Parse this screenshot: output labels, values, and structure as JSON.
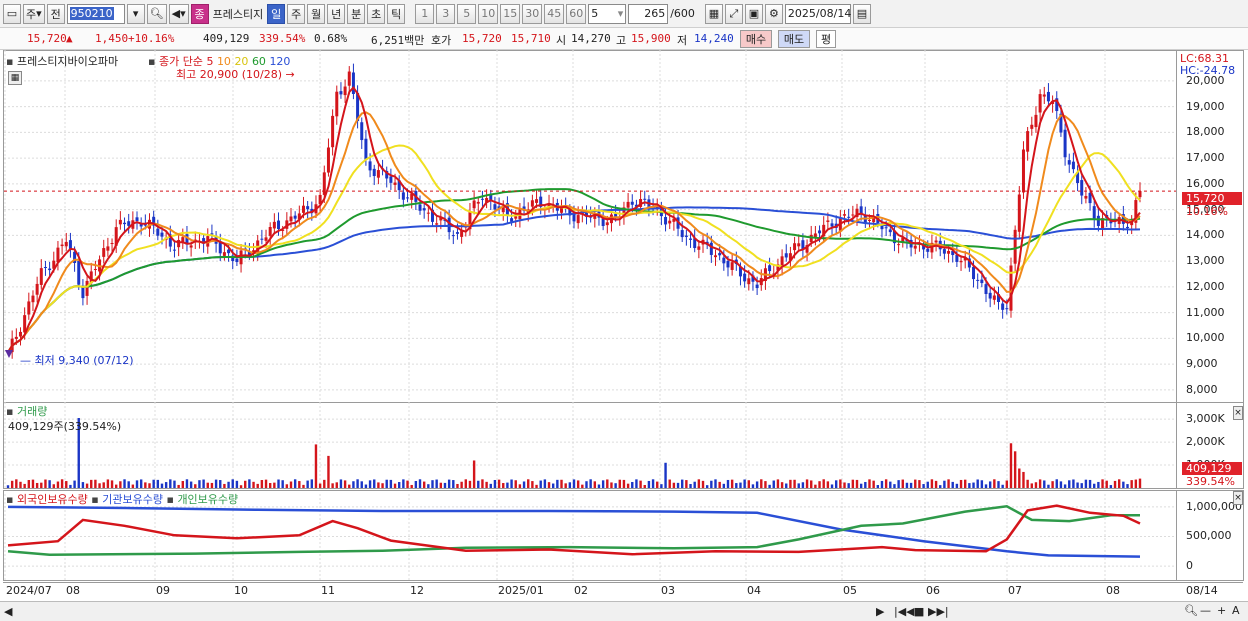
{
  "toolbar": {
    "market": "주",
    "code_prefix": "전",
    "code": "950210",
    "stock_badge": "종",
    "stock_name": "프레스티지",
    "periods": [
      "일",
      "주",
      "월",
      "년",
      "분",
      "초",
      "틱"
    ],
    "minutes": [
      "1",
      "3",
      "5",
      "10",
      "15",
      "30",
      "45",
      "60"
    ],
    "interval": "5",
    "count": "265",
    "count_max": "/600",
    "date": "2025/08/14"
  },
  "quote": {
    "price": "15,720",
    "change": "1,450",
    "change_pct": "+10.16%",
    "volume": "409,129",
    "volume_ratio": "339.54%",
    "turnover": "0.68%",
    "amount": "6,251백만",
    "hoga_label": "호가",
    "ask": "15,720",
    "bid": "15,710",
    "open_label": "시",
    "open": "14,270",
    "high_label": "고",
    "high": "15,900",
    "low_label": "저",
    "low": "14,240",
    "buy_label": "매수",
    "sell_label": "매도",
    "avg_label": "평"
  },
  "price_panel": {
    "name": "프레스티지바이오파마",
    "ma_label": "종가 단순",
    "ma_periods": [
      "5",
      "10",
      "20",
      "60",
      "120"
    ],
    "max_label": "최고 20,900 (10/28)",
    "min_label": "최저 9,340 (07/12)",
    "lc": "LC:68.31",
    "hc": "HC:-24.78",
    "current_price": "15,720",
    "current_pct": "10.16%",
    "yaxis": [
      "20,000",
      "19,000",
      "18,000",
      "17,000",
      "16,000",
      "15,000",
      "14,000",
      "13,000",
      "12,000",
      "11,000",
      "10,000",
      "9,000",
      "8,000"
    ]
  },
  "volume_panel": {
    "title": "거래량",
    "value": "409,129주(339.54%)",
    "yaxis": [
      "3,000K",
      "2,000K",
      "1,000K"
    ],
    "current": "409,129",
    "current_pct": "339.54%"
  },
  "holding_panel": {
    "foreign": "외국인보유수량",
    "institution": "기관보유수량",
    "individual": "개인보유수량",
    "yaxis": [
      "1,000,000",
      "500,000",
      "0"
    ]
  },
  "xaxis": [
    "2024/07",
    "08",
    "09",
    "10",
    "11",
    "12",
    "2025/01",
    "02",
    "03",
    "04",
    "05",
    "06",
    "07",
    "08"
  ],
  "xaxis_end": "08/14",
  "colors": {
    "up": "#d4151b",
    "down": "#1a35c6",
    "ma5": "#d4151b",
    "ma10": "#f08a1c",
    "ma20": "#f0e020",
    "ma60": "#1f9a2e",
    "ma120": "#2a4fd6",
    "foreign": "#d4151b",
    "institution": "#2a4fd6",
    "individual": "#2f9a4a"
  },
  "chart_data": {
    "type": "line",
    "series": [
      {
        "name": "종가",
        "x": [
          "2024/07/12",
          "2024/08",
          "2024/10/28",
          "2024/11",
          "2025/01",
          "2025/02",
          "2025/03/20",
          "2025/05",
          "2025/06/30",
          "2025/07/10",
          "2025/08/14"
        ],
        "values": [
          9340,
          13500,
          20900,
          15200,
          14500,
          15400,
          11600,
          14800,
          11000,
          19800,
          15720
        ]
      }
    ]
  }
}
